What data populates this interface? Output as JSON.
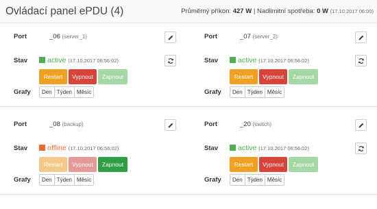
{
  "header": {
    "title": "Ovládací panel ePDU (4)",
    "avg_label": "Průměrný příkon:",
    "avg_value": "427 W",
    "separator": "|",
    "over_label": "Nadlimitní spotřeba:",
    "over_value": "0 W",
    "timestamp": "(17.10.2017 06:00)"
  },
  "labels": {
    "port": "Port",
    "stav": "Stav",
    "grafy": "Grafy"
  },
  "buttons": {
    "restart": "Restart",
    "off": "Vypnout",
    "on": "Zapnout"
  },
  "graph_buttons": [
    "Den",
    "Týden",
    "Měsíc"
  ],
  "colors": {
    "active": "#4caf50",
    "offline": "#f26b2b",
    "restart": "#f0a121",
    "off": "#d9443a",
    "on": "#5cb85c",
    "on_active": "#2f9e44"
  },
  "ports": [
    {
      "port": "_06",
      "device": "(server_1)",
      "status": "active",
      "status_time": "(17.10.2017 06:56:02)"
    },
    {
      "port": "_07",
      "device": "(server_2)",
      "status": "active",
      "status_time": "(17.10.2017 06:56:02)"
    },
    {
      "port": "_08",
      "device": "(backup)",
      "status": "offline",
      "status_time": "(17.10.2017 06:56:02)"
    },
    {
      "port": "_20",
      "device": "(switch)",
      "status": "active",
      "status_time": "(17.10.2017 06:56:02)"
    }
  ]
}
